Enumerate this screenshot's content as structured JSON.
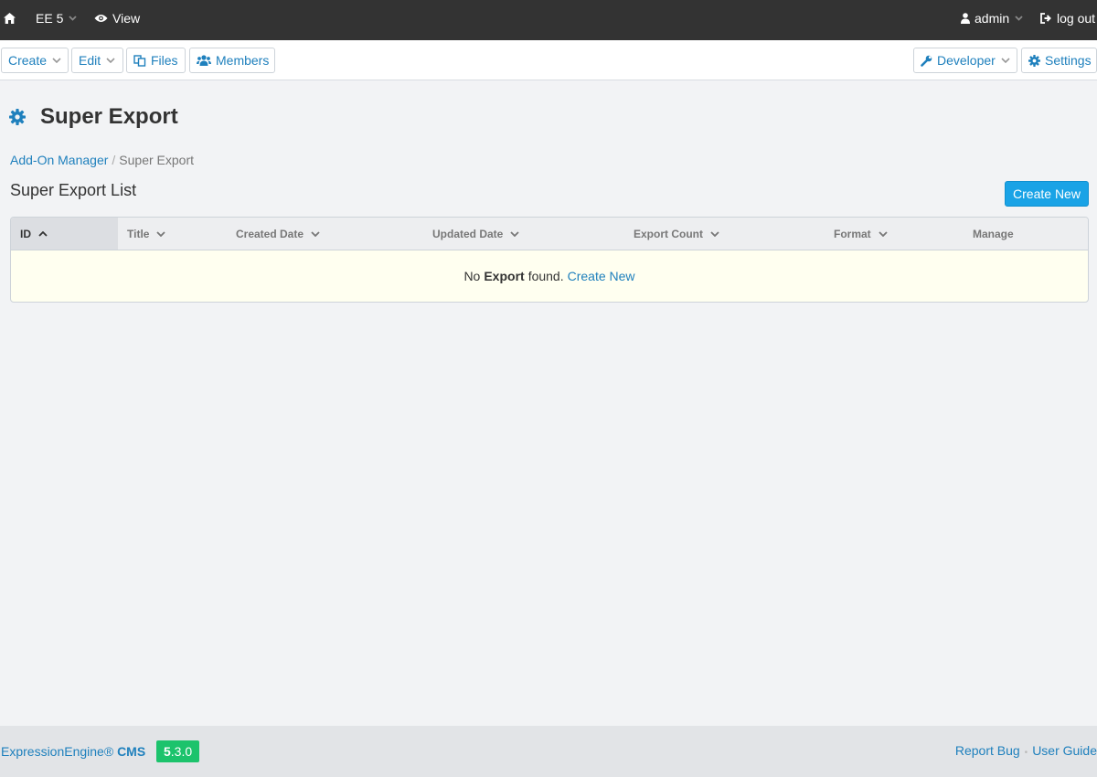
{
  "topbar": {
    "site_name": "EE 5",
    "view_label": "View",
    "user_label": "admin",
    "logout_label": "log out"
  },
  "nav": {
    "create_label": "Create",
    "edit_label": "Edit",
    "files_label": "Files",
    "members_label": "Members",
    "developer_label": "Developer",
    "settings_label": "Settings"
  },
  "page": {
    "title": "Super Export",
    "breadcrumb_parent": "Add-On Manager",
    "breadcrumb_separator": "/",
    "breadcrumb_current": "Super Export",
    "section_title": "Super Export List",
    "create_button": "Create New"
  },
  "table": {
    "columns": [
      "ID",
      "Title",
      "Created Date",
      "Updated Date",
      "Export Count",
      "Format",
      "Manage"
    ],
    "empty_prefix": "No",
    "empty_bold": "Export",
    "empty_suffix": "found.",
    "empty_link": "Create New"
  },
  "footer": {
    "brand": "ExpressionEngine®",
    "brand_bold": "CMS",
    "version_major": "5",
    "version_minor": ".3.0",
    "report_bug": "Report Bug",
    "separator": "•",
    "user_guide": "User Guide"
  },
  "colors": {
    "topbar_bg": "#333333",
    "link_blue": "#1f80bd",
    "button_blue": "#1aa3e6",
    "version_green": "#1cc36c",
    "empty_row_bg": "#fffff0"
  }
}
